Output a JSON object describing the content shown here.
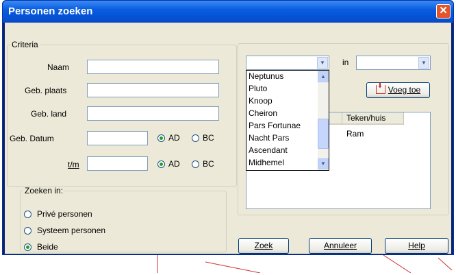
{
  "window": {
    "title": "Personen zoeken"
  },
  "criteria": {
    "legend": "Criteria",
    "naam_label": "Naam",
    "geb_plaats_label": "Geb. plaats",
    "geb_land_label": "Geb. land",
    "geb_datum_label": "Geb. Datum",
    "tm_label": "t/m",
    "ad_label": "AD",
    "bc_label": "BC",
    "datum_era_selected": "AD",
    "tm_era_selected": "AD"
  },
  "zoeken_in": {
    "legend": "Zoeken in:",
    "options": [
      "Privé personen",
      "Systeem personen",
      "Beide"
    ],
    "selected": "Beide"
  },
  "filter": {
    "in_label": "in",
    "voeg_toe_label": "Voeg toe",
    "dropdown_items": [
      "Neptunus",
      "Pluto",
      "Knoop",
      "Cheiron",
      "Pars Fortunae",
      "Nacht Pars",
      "Ascendant",
      "Midhemel"
    ],
    "list_headers": [
      "Teken/huis"
    ],
    "list_rows": [
      {
        "teken": "Ram"
      }
    ]
  },
  "buttons": {
    "zoek": "Zoek",
    "annuleer": "Annuleer",
    "help": "Help"
  },
  "colors": {
    "titlebar": "#0a5de0",
    "dialog_bg": "#ece9d8",
    "close": "#e2552c",
    "voeg_toe_icon": "#c8301f"
  }
}
